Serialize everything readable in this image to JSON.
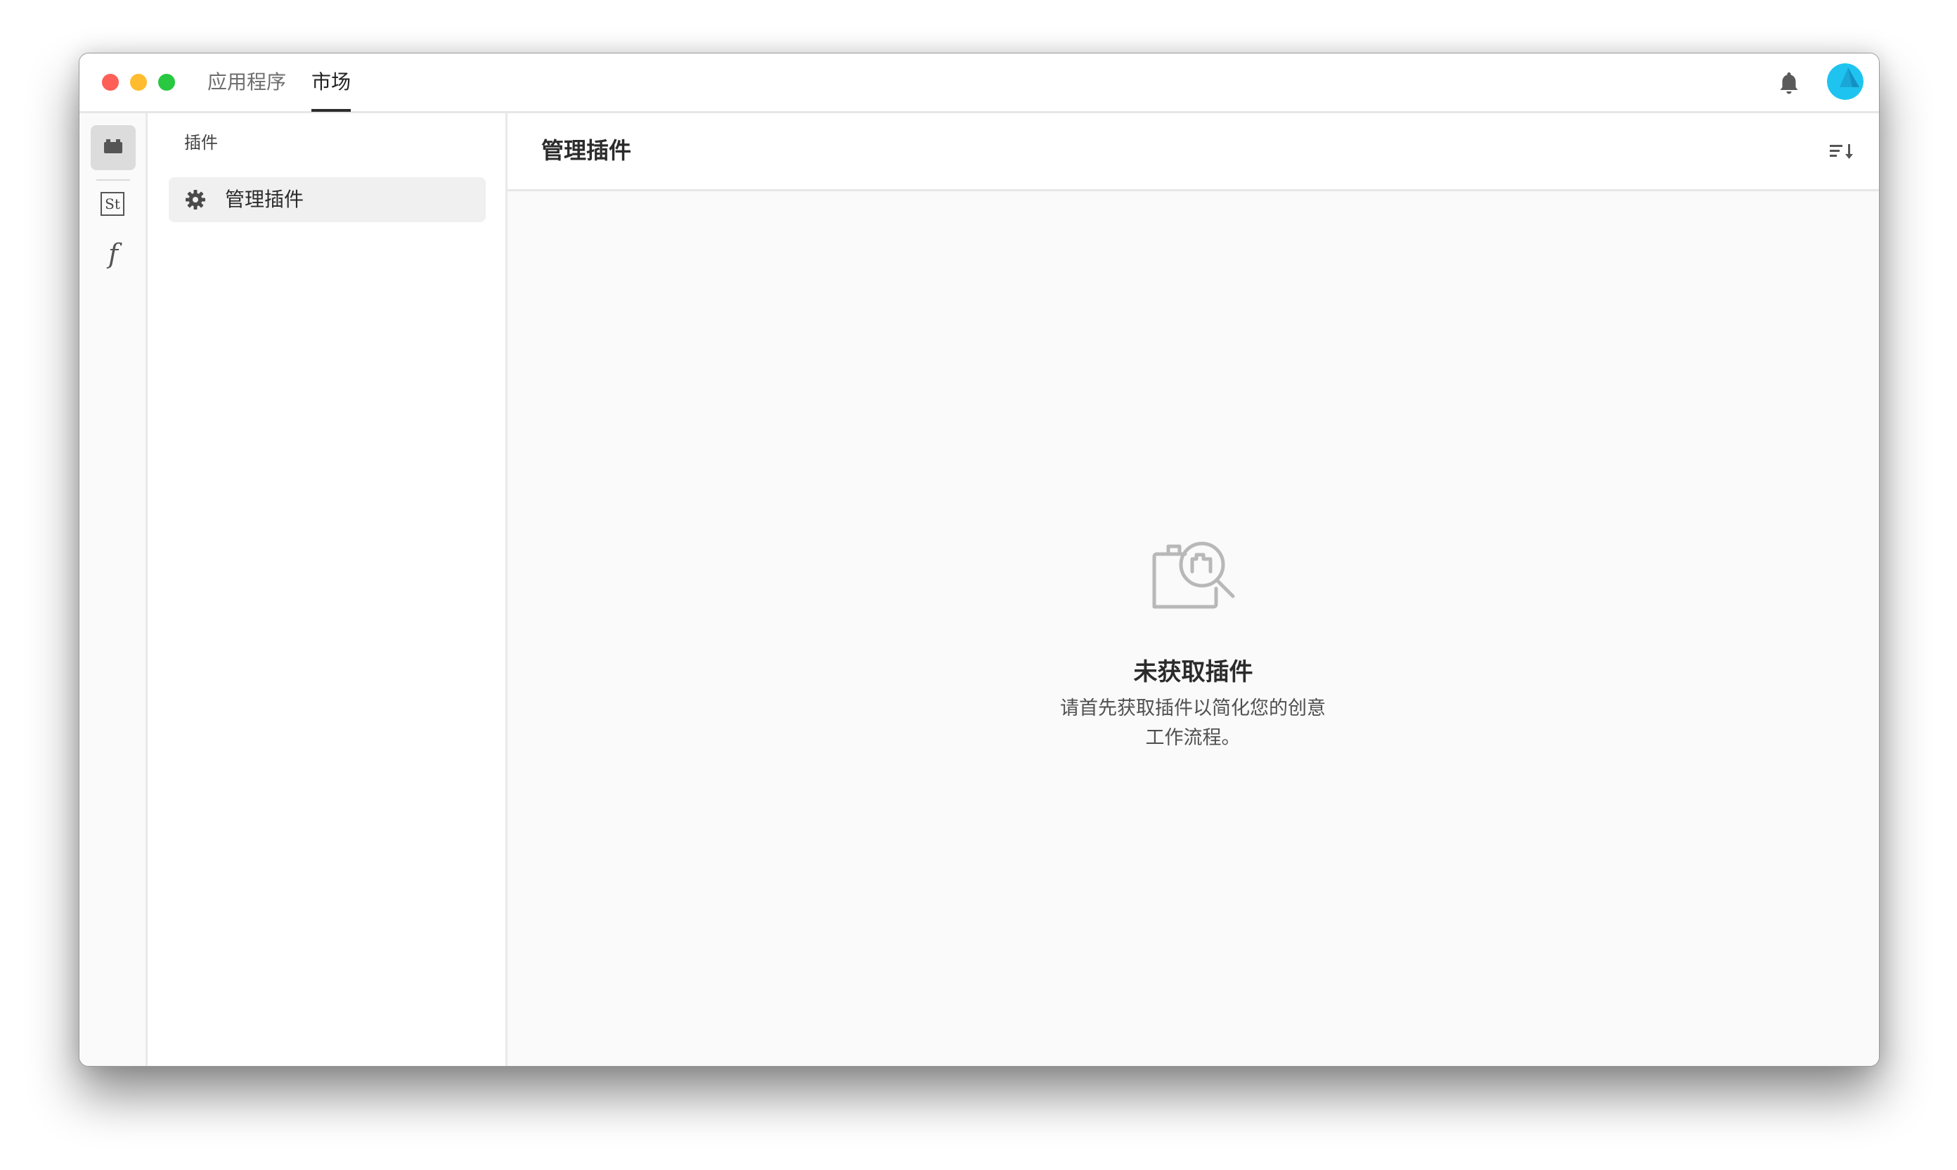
{
  "titlebar": {
    "tabs": [
      {
        "label": "应用程序"
      },
      {
        "label": "市场"
      }
    ],
    "active_tab": "市场"
  },
  "rail": {
    "items": [
      {
        "icon": "plugin-icon",
        "active": true
      },
      {
        "icon": "stock-icon",
        "text": "St"
      },
      {
        "icon": "fonts-icon",
        "text": "f"
      }
    ]
  },
  "sidebar": {
    "heading": "插件",
    "items": [
      {
        "icon": "gear-icon",
        "label": "管理插件",
        "selected": true
      }
    ]
  },
  "main": {
    "title": "管理插件",
    "empty_state": {
      "title": "未获取插件",
      "description": "请首先获取插件以简化您的创意工作流程。"
    }
  },
  "colors": {
    "close": "#fe5f57",
    "minimize": "#febc2e",
    "maximize": "#28c840",
    "avatar": "#1ec4ef"
  }
}
